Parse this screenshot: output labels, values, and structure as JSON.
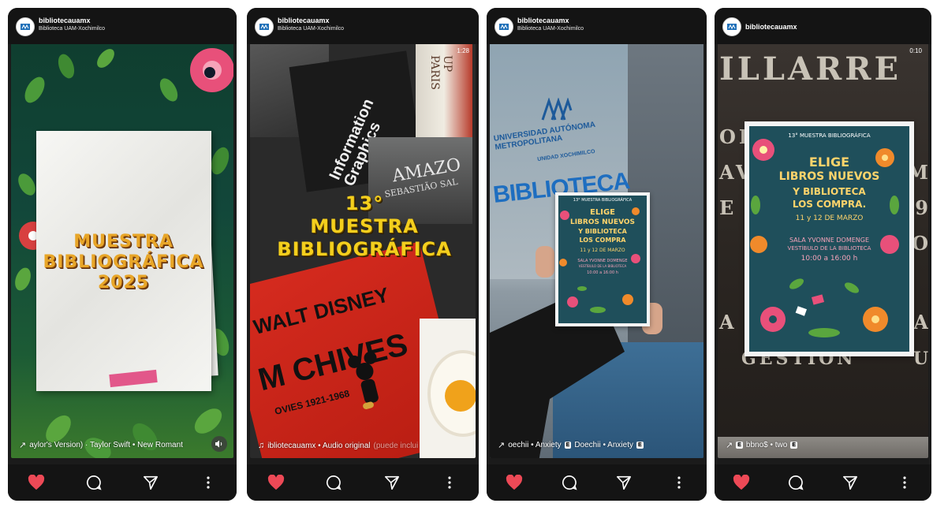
{
  "colors": {
    "like": "#ed4956",
    "card_bg": "#141414",
    "accent_gold": "#e8a628"
  },
  "cards": [
    {
      "username": "bibliotecauamx",
      "subtitle": "Biblioteca UAM-Xochimilco",
      "poster_text": [
        "MUESTRA",
        "BIBLIOGRÁFICA",
        "2025"
      ],
      "audio": "aylor's Version) · Taylor Swift • New Romant",
      "icons": [
        "like-icon",
        "comment-icon",
        "share-icon",
        "more-icon"
      ]
    },
    {
      "username": "bibliotecauamx",
      "subtitle": "Biblioteca UAM-Xochimilco",
      "timer": "1:28",
      "title_lines": [
        "13°",
        "MUESTRA",
        "BIBLIOGRÁFICA"
      ],
      "book_texts": {
        "info": "Information Graphics",
        "amazo": "AMAZO",
        "salgado": "SEBASTIÃO SAL",
        "disney": "WALT DISNEY",
        "archives": "M CHIVES",
        "movies": "OVIES 1921-1968",
        "paris": "UP PARIS"
      },
      "audio_main": "ibliotecauamx • Audio original",
      "audio_faded": "(puede inclui",
      "icons": [
        "like-icon",
        "comment-icon",
        "share-icon",
        "more-icon"
      ]
    },
    {
      "username": "bibliotecauamx",
      "subtitle": "Biblioteca UAM-Xochimilco",
      "building_text": [
        "UNIVERSIDAD AUTÓNOMA METROPOLITANA",
        "UNIDAD XOCHIMILCO",
        "BIBLIOTECA"
      ],
      "poster": {
        "header": "13° MUESTRA BIBLIOGRÁFICA",
        "lines": [
          "ELIGE",
          "LIBROS NUEVOS",
          "Y BIBLIOTECA",
          "LOS COMPRA"
        ],
        "dates": "11 y 12 DE MARZO",
        "venue": [
          "SALA YVONNE DOMENGE",
          "VESTÍBULO DE LA BIBLIOTECA"
        ],
        "time": "10:00 a 16:00 h"
      },
      "audio_parts": [
        "oechii • Anxiety",
        "Doechii • Anxiety"
      ],
      "explicit_label": "E",
      "icons": [
        "like-icon",
        "comment-icon",
        "share-icon",
        "more-icon"
      ]
    },
    {
      "username": "bibliotecauamx",
      "timer": "0:10",
      "wall_text": {
        "top": "ILLARRE",
        "left": [
          "OR",
          "AV",
          "E",
          "A",
          "GESTION"
        ],
        "right": [
          "M",
          "19",
          "IO",
          "IA",
          "U"
        ]
      },
      "poster": {
        "header": "13° MUESTRA BIBLIOGRÁFICA",
        "lines": [
          "ELIGE",
          "LIBROS NUEVOS",
          "Y BIBLIOTECA",
          "LOS COMPRA."
        ],
        "dates": "11 y 12 DE MARZO",
        "venue": [
          "SALA YVONNE DOMENGE",
          "VESTÍBULO DE LA BIBLIOTECA"
        ],
        "time": "10:00 a 16:00 h"
      },
      "audio": "bbno$ • two",
      "explicit_label": "E",
      "icons": [
        "like-icon",
        "comment-icon",
        "share-icon",
        "more-icon"
      ]
    }
  ]
}
